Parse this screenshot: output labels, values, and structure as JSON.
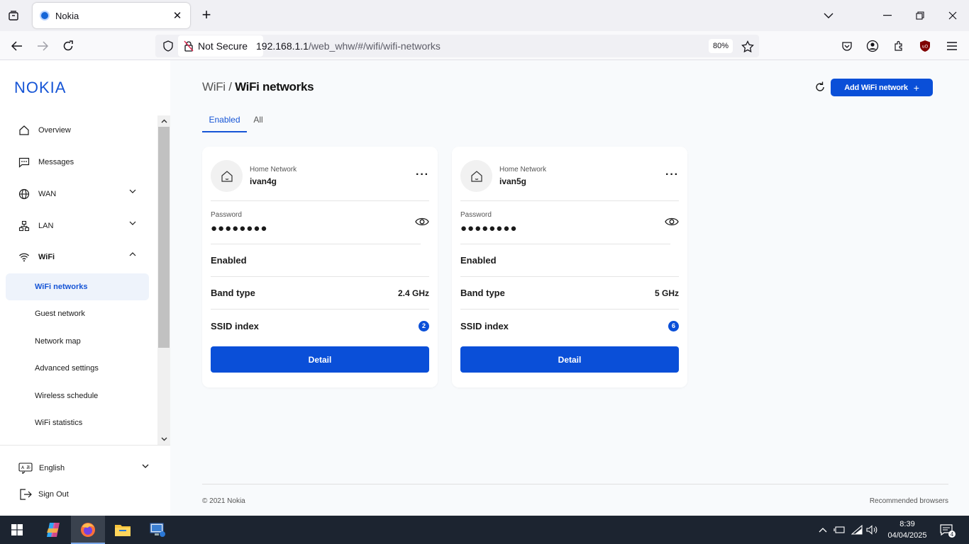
{
  "browser": {
    "tab_title": "Nokia",
    "security_label": "Not Secure",
    "url_host": "192.168.1.1",
    "url_path": "/web_whw/#/wifi/wifi-networks",
    "zoom": "80%"
  },
  "app": {
    "logo_text": "NOKIA",
    "breadcrumb_parent": "WiFi /",
    "breadcrumb_current": "WiFi networks",
    "add_button_label": "Add WiFi network"
  },
  "sidebar": {
    "items": [
      {
        "label": "Overview",
        "icon": "home-icon"
      },
      {
        "label": "Messages",
        "icon": "message-icon"
      },
      {
        "label": "WAN",
        "icon": "globe-icon"
      },
      {
        "label": "LAN",
        "icon": "lan-icon"
      },
      {
        "label": "WiFi",
        "icon": "wifi-icon"
      }
    ],
    "subitems": [
      {
        "label": "WiFi networks",
        "active": true
      },
      {
        "label": "Guest network"
      },
      {
        "label": "Network map"
      },
      {
        "label": "Advanced settings"
      },
      {
        "label": "Wireless schedule"
      },
      {
        "label": "WiFi statistics"
      }
    ],
    "language": "English",
    "signout": "Sign Out"
  },
  "tabs": {
    "enabled": "Enabled",
    "all": "All"
  },
  "networks": [
    {
      "type": "Home Network",
      "name": "ivan4g",
      "password_label": "Password",
      "password_masked": "●●●●●●●●",
      "status": "Enabled",
      "band_label": "Band type",
      "band_value": "2.4 GHz",
      "ssid_label": "SSID index",
      "ssid_value": "2",
      "detail_label": "Detail"
    },
    {
      "type": "Home Network",
      "name": "ivan5g",
      "password_label": "Password",
      "password_masked": "●●●●●●●●",
      "status": "Enabled",
      "band_label": "Band type",
      "band_value": "5 GHz",
      "ssid_label": "SSID index",
      "ssid_value": "6",
      "detail_label": "Detail"
    }
  ],
  "footer": {
    "copyright": "© 2021 Nokia",
    "recommended": "Recommended browsers"
  },
  "taskbar": {
    "time": "8:39",
    "date": "04/04/2025",
    "notifications": "4"
  },
  "colors": {
    "accent": "#0a4fd8",
    "active_bg": "#eef3fb"
  }
}
